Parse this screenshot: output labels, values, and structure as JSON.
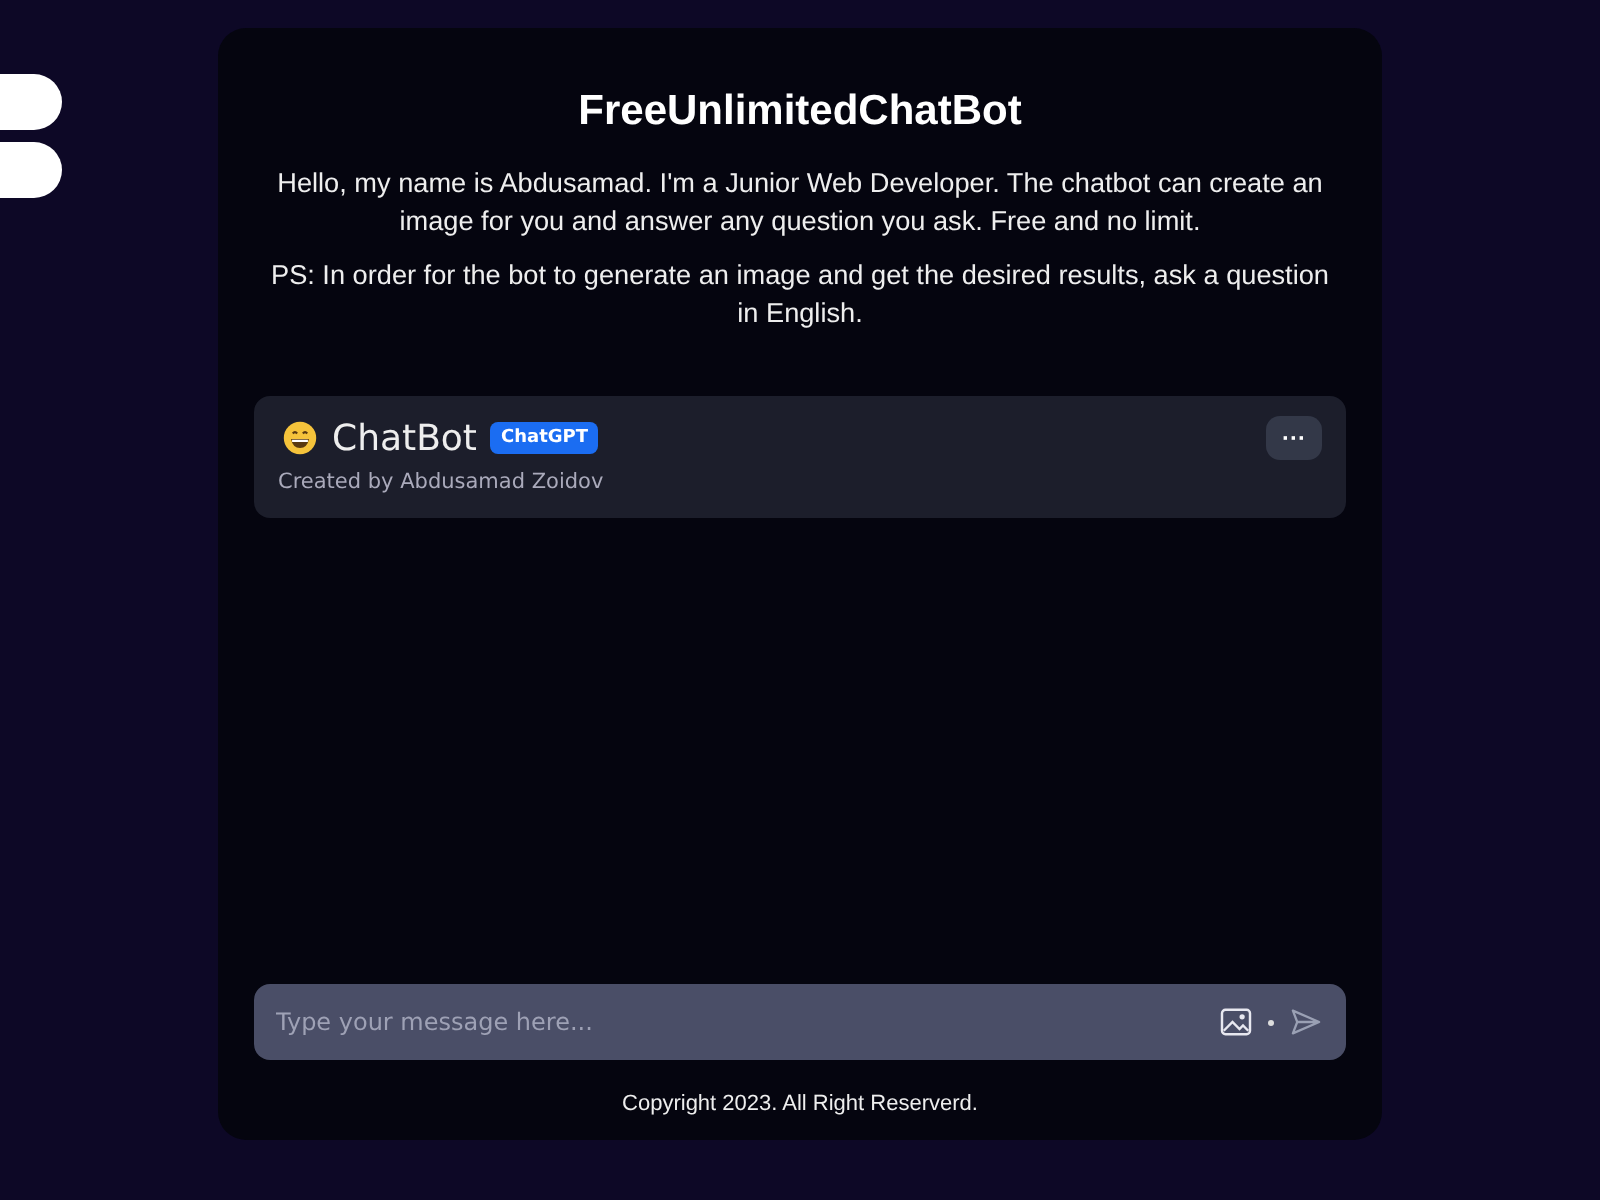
{
  "title": "FreeUnlimitedChatBot",
  "intro": [
    "Hello, my name is Abdusamad. I'm a Junior Web Developer. The chatbot can create an image for you and answer any question you ask. Free and no limit.",
    "PS: In order for the bot to generate an image and get the desired results, ask a question in English."
  ],
  "chat": {
    "name": "ChatBot",
    "badge": "ChatGPT",
    "subtitle": "Created by Abdusamad Zoidov",
    "menu": "···"
  },
  "input": {
    "placeholder": "Type your message here..."
  },
  "footer": "Copyright 2023. All Right Reserverd."
}
